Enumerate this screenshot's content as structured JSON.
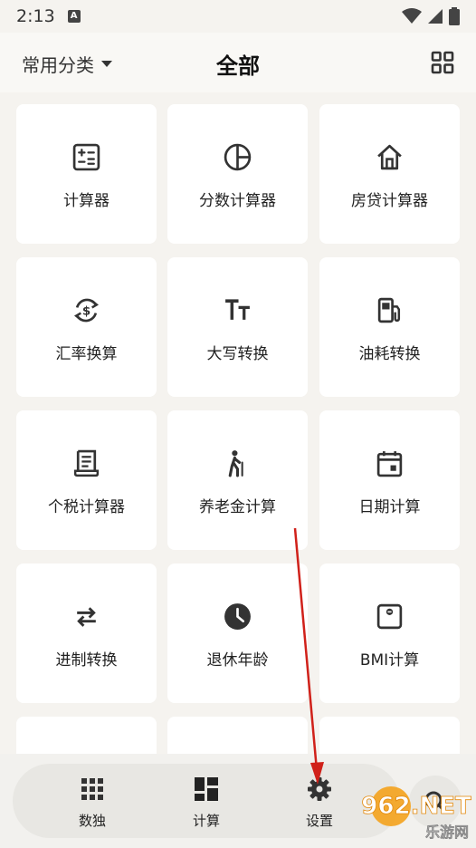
{
  "status": {
    "time": "2:13",
    "notif": "A"
  },
  "header": {
    "category": "常用分类",
    "title": "全部"
  },
  "cards": [
    {
      "label": "计算器",
      "icon": "calculator-icon"
    },
    {
      "label": "分数计算器",
      "icon": "pie-fraction-icon"
    },
    {
      "label": "房贷计算器",
      "icon": "house-icon"
    },
    {
      "label": "汇率换算",
      "icon": "currency-exchange-icon"
    },
    {
      "label": "大写转换",
      "icon": "text-size-icon"
    },
    {
      "label": "油耗转换",
      "icon": "fuel-pump-icon"
    },
    {
      "label": "个税计算器",
      "icon": "receipt-icon"
    },
    {
      "label": "养老金计算",
      "icon": "elderly-icon"
    },
    {
      "label": "日期计算",
      "icon": "calendar-icon"
    },
    {
      "label": "进制转换",
      "icon": "swap-arrows-icon"
    },
    {
      "label": "退休年龄",
      "icon": "clock-icon"
    },
    {
      "label": "BMI计算",
      "icon": "scale-icon"
    }
  ],
  "nav": [
    {
      "label": "数独",
      "icon": "grid-dots-icon"
    },
    {
      "label": "计算",
      "icon": "dashboard-icon"
    },
    {
      "label": "设置",
      "icon": "gear-icon"
    }
  ],
  "watermark": {
    "brand": "962.NET",
    "sub": "乐游网"
  },
  "colors": {
    "icon": "#333333",
    "card": "#ffffff",
    "background": "#f5f3ef",
    "arrow": "#d0211a"
  }
}
